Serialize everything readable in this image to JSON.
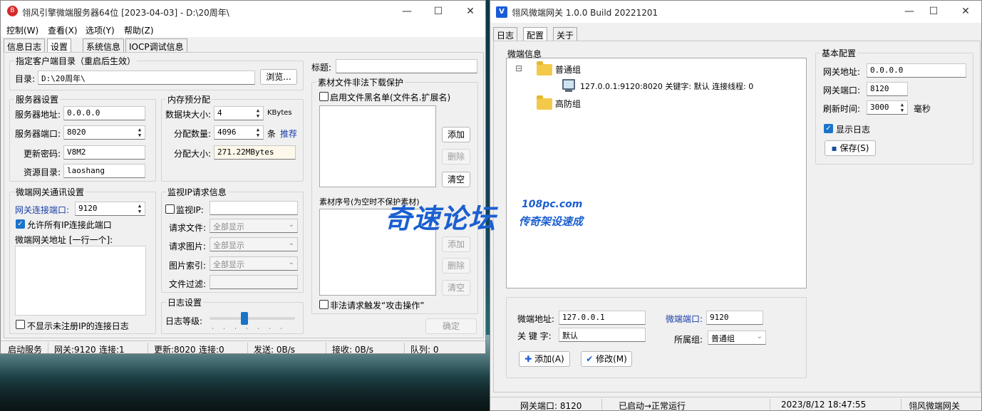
{
  "left_window": {
    "title": "翎风引擎微端服务器64位 [2023-04-03] - D:\\20周年\\",
    "menu": [
      "控制(W)",
      "查看(X)",
      "选项(Y)",
      "帮助(Z)"
    ],
    "tabs": [
      "信息日志",
      "设置",
      "系统信息",
      "IOCP调试信息"
    ],
    "client_dir": {
      "group": "指定客户端目录（重启后生效）",
      "label": "目录:",
      "value": "D:\\20周年\\",
      "browse": "浏览..."
    },
    "server": {
      "group": "服务器设置",
      "addr_label": "服务器地址:",
      "addr": "0.0.0.0",
      "port_label": "服务器端口:",
      "port": "8020",
      "pwd_label": "更新密码:",
      "pwd": "V8M2",
      "res_label": "资源目录:",
      "res": "laoshang"
    },
    "memory": {
      "group": "内存预分配",
      "block_label": "数据块大小:",
      "block": "4",
      "block_unit": "KBytes",
      "count_label": "分配数量:",
      "count": "4096",
      "count_unit": "条",
      "recommend": "推荐",
      "size_label": "分配大小:",
      "size": "271.22MBytes"
    },
    "gateway": {
      "group": "微端网关通讯设置",
      "port_label": "网关连接端口:",
      "port": "9120",
      "allow_all": "允许所有IP连接此端口",
      "addr_label": "微端网关地址 [一行一个]:",
      "hide_unreg": "不显示未注册IP的连接日志"
    },
    "monitor": {
      "group": "监视IP请求信息",
      "ip_label": "监视IP:",
      "file_label": "请求文件:",
      "file": "全部显示",
      "img_label": "请求图片:",
      "img": "全部显示",
      "idx_label": "图片索引:",
      "idx": "全部显示",
      "filter_label": "文件过滤:"
    },
    "log": {
      "group": "日志设置",
      "level_label": "日志等级:"
    },
    "protect": {
      "title_label": "标题:",
      "group": "素材文件非法下载保护",
      "blacklist": "启用文件黑名单(文件名.扩展名)",
      "add": "添加",
      "del": "删除",
      "clear": "清空",
      "seq_label": "素材序号(为空时不保护素材)",
      "attack": "非法请求触发“攻击操作”",
      "ok": "确定"
    },
    "status": [
      "启动服务",
      "网关:9120",
      "连接:1",
      "更新:8020",
      "连接:0",
      "发送: 0B/s",
      "接收: 0B/s",
      "队列: 0"
    ]
  },
  "right_window": {
    "title": "翎风微端网关 1.0.0 Build 20221201",
    "tabs": [
      "日志",
      "配置",
      "关于"
    ],
    "info_group": "微端信息",
    "tree": {
      "expander": "⊟",
      "group1": "普通组",
      "node": "127.0.0.1:9120:8020 关键字: 默认 连接线程: 0",
      "group2": "高防组"
    },
    "form": {
      "addr_label": "微端地址:",
      "addr": "127.0.0.1",
      "port_label": "微端端口:",
      "port": "9120",
      "key_label": "关 键 字:",
      "key": "默认",
      "group_label": "所属组:",
      "group": "普通组",
      "add": "添加(A)",
      "modify": "修改(M)"
    },
    "basic": {
      "group": "基本配置",
      "addr_label": "网关地址:",
      "addr": "0.0.0.0",
      "port_label": "网关端口:",
      "port": "8120",
      "refresh_label": "刷新时间:",
      "refresh": "3000",
      "refresh_unit": "毫秒",
      "show_log": "显示日志",
      "save": "保存(S)"
    },
    "status": [
      "网关端口: 8120",
      "已启动→正常运行",
      "2023/8/12 18:47:55",
      "翎风微端网关"
    ]
  },
  "watermark": {
    "main": "奇速论坛",
    "site": "108pc.com",
    "sub": "传奇架设速成"
  },
  "colors": {
    "accent": "#1a73c8",
    "link": "#1a3ea8",
    "watermark": "#1a5fd0"
  }
}
